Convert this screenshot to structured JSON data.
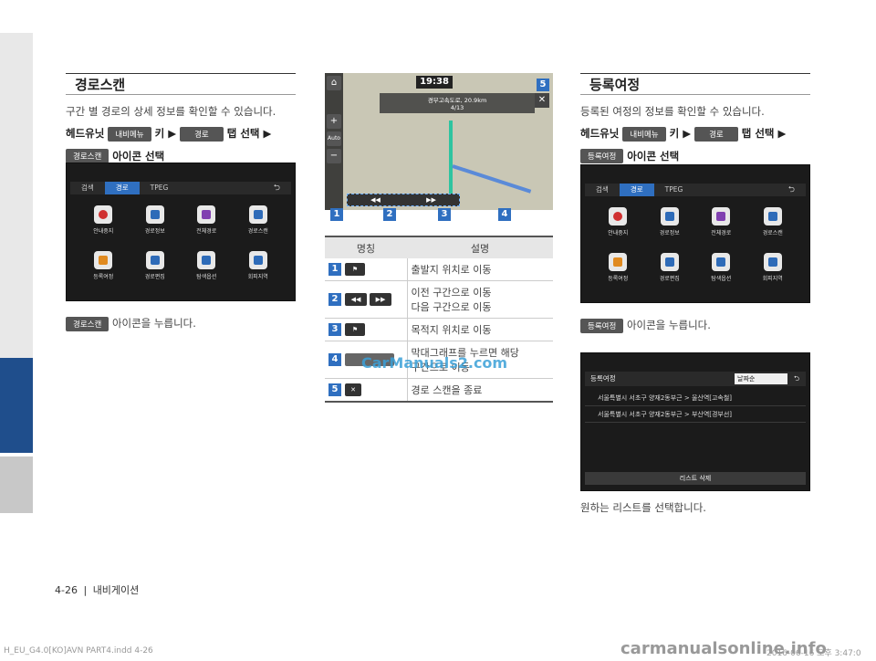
{
  "left": {
    "title": "경로스캔",
    "desc": "구간 별 경로의 상세 정보를 확인할 수 있습니다.",
    "step1": {
      "pre": "헤드유닛",
      "chip1": "내비메뉴",
      "mid": "키 ▶",
      "chip2": "경로",
      "post": "탭 선택 ▶"
    },
    "step2": {
      "chip": "경로스캔",
      "post": "아이콘 선택"
    },
    "caption": {
      "chip": "경로스캔",
      "text": "아이콘을 누릅니다."
    }
  },
  "screen": {
    "tabs": [
      "검색",
      "경로",
      "TPEG"
    ],
    "back": "⮌",
    "icons": [
      "안내중지",
      "경로정보",
      "전체경로",
      "경로스캔",
      "등록여정",
      "경로편집",
      "탐색옵션",
      "회피지역"
    ]
  },
  "map": {
    "time": "19:38",
    "road": "경부고속도로, 20.9km",
    "page": "4/13",
    "close": "✕",
    "btn_home": "⌂",
    "btn_plus": "+",
    "btn_minus": "−",
    "btn_auto": "Auto",
    "ctl_prev": "◀◀",
    "ctl_next": "▶▶",
    "badges": [
      "1",
      "2",
      "3",
      "4",
      "5"
    ]
  },
  "table": {
    "h1": "명칭",
    "h2": "설명",
    "rows": [
      {
        "n": "1",
        "d": "출발지 위치로 이동"
      },
      {
        "n": "2",
        "d": "이전 구간으로 이동",
        "d2": "다음 구간으로 이동"
      },
      {
        "n": "3",
        "d": "목적지 위치로 이동"
      },
      {
        "n": "4",
        "d": "막대그래프를 누르면 해당",
        "d2": "구간으로 이동"
      },
      {
        "n": "5",
        "d": "경로 스캔을 종료"
      }
    ]
  },
  "right": {
    "title": "등록여정",
    "desc": "등록된 여정의 정보를 확인할 수 있습니다.",
    "step1": {
      "pre": "헤드유닛",
      "chip1": "내비메뉴",
      "mid": "키 ▶",
      "chip2": "경로",
      "post": "탭 선택 ▶"
    },
    "step2": {
      "chip": "등록여정",
      "post": "아이콘 선택"
    },
    "caption": {
      "chip": "등록여정",
      "text": "아이콘을 누릅니다."
    },
    "list": {
      "title": "등록여정",
      "sort": "날짜순",
      "items": [
        "서울특별시 서초구 양재2동부근 > 울산역[고속철]",
        "서울특별시 서초구 양재2동부근 > 부산역[경부선]"
      ],
      "delete": "리스트 삭제"
    },
    "caption2": "원하는 리스트를 선택합니다."
  },
  "footer": {
    "page": "4-26",
    "section": "내비게이션"
  },
  "watermark": "CarManuals2.com",
  "watermark2": "carmanualsonline.info",
  "slug": "H_EU_G4.0[KO]AVN PART4.indd   4-26",
  "slug2": "2016-06-16   오후 3:47:0"
}
